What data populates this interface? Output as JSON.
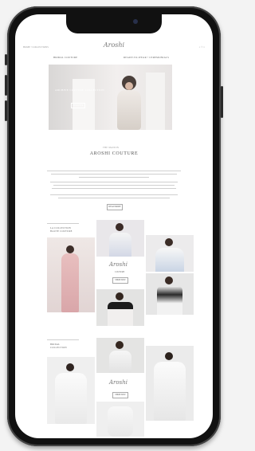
{
  "header": {
    "left_links": "HOME • COLLECTIONS",
    "logo": "Aroshi",
    "right_icons": [
      "search-icon",
      "heart-icon",
      "bag-icon"
    ]
  },
  "subnav": {
    "left": "BRIDAL COUTURE",
    "right": "READY-TO-WEAR • CEREMONIALS"
  },
  "hero": {
    "caption": "ARCHIVE COUTURE COLLECTION",
    "button": "DISCOVER"
  },
  "section_intro": {
    "overline": "THE MAISON",
    "title": "AROSHI COUTURE",
    "button": "READ MORE"
  },
  "grid1": {
    "label": "LA COLLECTION",
    "sublabel": "HAUTE COUTURE",
    "center_logo": "Aroshi",
    "center_text": "COUTURE",
    "button": "SHOP NOW"
  },
  "grid2": {
    "label": "BRIDAL",
    "sublabel": "COLLECTION",
    "center_logo": "Aroshi",
    "button": "SHOP NOW"
  },
  "colors": {
    "frame": "#111111",
    "screen": "#ffffff",
    "accent": "#777777"
  }
}
